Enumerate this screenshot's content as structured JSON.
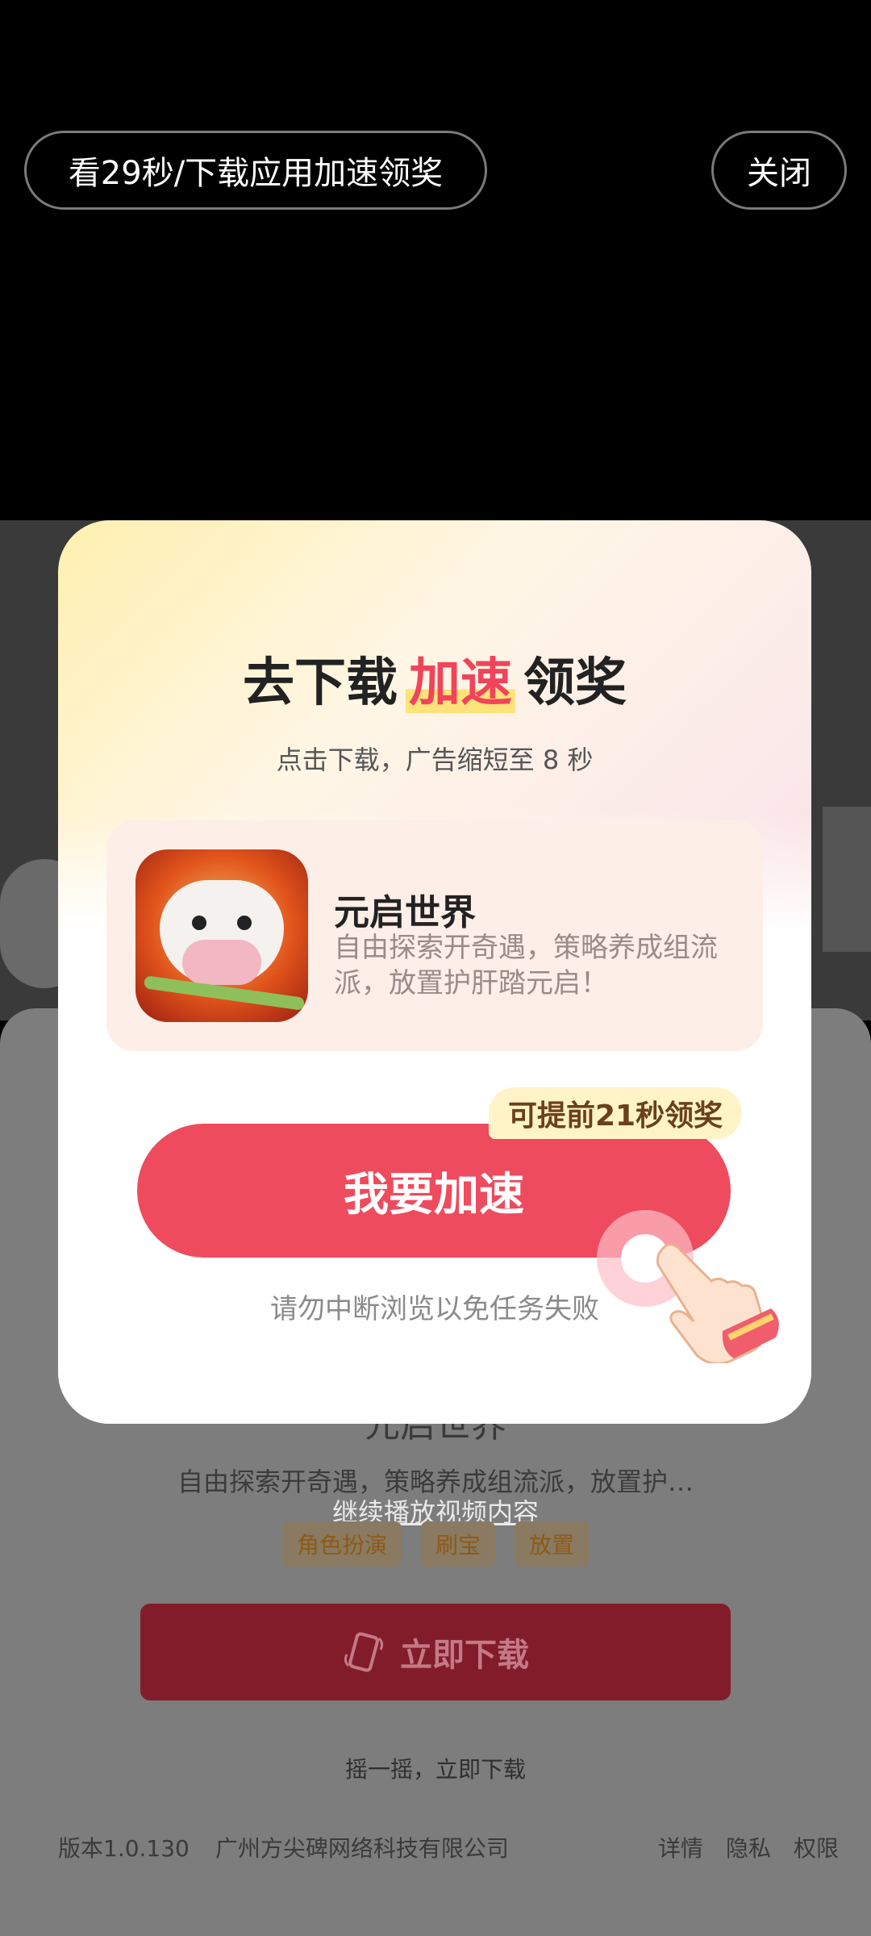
{
  "top_bar": {
    "timer_label": "看29秒/下载应用加速领奖",
    "close_label": "关闭"
  },
  "dialog": {
    "title_prefix": "去下载",
    "title_highlight": "加速",
    "title_suffix": "领奖",
    "subtitle": "点击下载，广告缩短至 8 秒",
    "app": {
      "name": "元启世界",
      "description": "自由探索开奇遇，策略养成组流派，放置护肝踏元启！",
      "icon": "cow-warrior-app-icon"
    },
    "badge": "可提前21秒领奖",
    "speed_button": "我要加速",
    "warning": "请勿中断浏览以免任务失败"
  },
  "sheet": {
    "app_name": "元启世界",
    "description": "自由探索开奇遇，策略养成组流派，放置护…",
    "continue_link": "继续播放视频内容",
    "tags": [
      "角色扮演",
      "刷宝",
      "放置"
    ],
    "download_label": "立即下载",
    "shake_text": "摇一摇，立即下载",
    "footer": {
      "version": "版本1.0.130",
      "company": "广州方尖碑网络科技有限公司",
      "details": "详情",
      "privacy": "隐私",
      "permissions": "权限"
    }
  },
  "colors": {
    "accent": "#ee4b5e",
    "dim_download": "#821c2b"
  }
}
